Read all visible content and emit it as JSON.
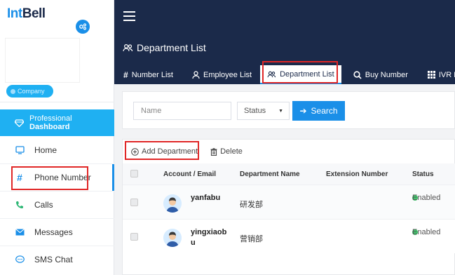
{
  "brand": {
    "part1": "Int",
    "part2": "Bell"
  },
  "sidebar": {
    "company_label": "Company",
    "dashboard": {
      "prefix": "Professional",
      "bold": "Dashboard"
    },
    "items": [
      {
        "label": "Home",
        "icon": "monitor-icon"
      },
      {
        "label": "Phone Number",
        "icon": "hash-icon"
      },
      {
        "label": "Calls",
        "icon": "phone-icon"
      },
      {
        "label": "Messages",
        "icon": "mail-icon"
      },
      {
        "label": "SMS Chat",
        "icon": "chat-icon"
      }
    ]
  },
  "header": {
    "title": "Department List",
    "tabs": [
      {
        "label": "Number List",
        "icon": "#"
      },
      {
        "label": "Employee List",
        "icon": "person-icon"
      },
      {
        "label": "Department List",
        "icon": "group-icon"
      },
      {
        "label": "Buy Number",
        "icon": "search-icon"
      },
      {
        "label": "IVR Li",
        "icon": "grid-icon"
      }
    ]
  },
  "search": {
    "name_placeholder": "Name",
    "status_value": "Status",
    "search_label": "Search"
  },
  "toolbar": {
    "add_label": "Add Department",
    "delete_label": "Delete"
  },
  "table": {
    "columns": [
      "Account / Email",
      "Department Name",
      "Extension Number",
      "Status"
    ],
    "rows": [
      {
        "account": "yanfabu",
        "department": "研发部",
        "extension": "",
        "status": "Enabled"
      },
      {
        "account": "yingxiaobu",
        "department": "营销部",
        "extension": "",
        "status": "Enabled"
      }
    ]
  },
  "colors": {
    "navy": "#1b2a4a",
    "accent": "#1a8fe8",
    "highlight": "#e02727",
    "enabled": "#3fc46b"
  }
}
